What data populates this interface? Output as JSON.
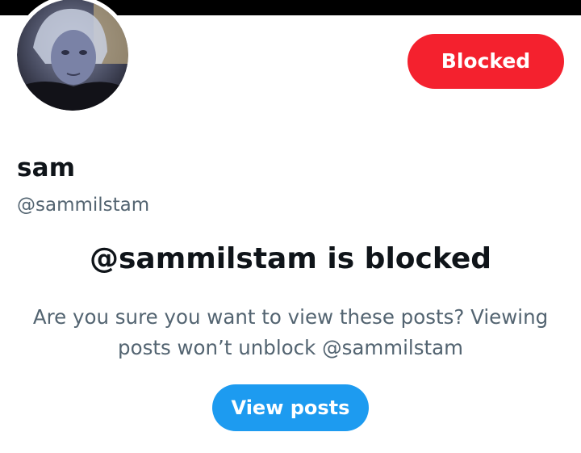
{
  "profile": {
    "name": "sam",
    "handle": "@sammilstam",
    "avatar_alt": "profile photo"
  },
  "actions": {
    "blocked_label": "Blocked",
    "view_posts_label": "View posts"
  },
  "blocked_notice": {
    "heading": "@sammilstam is blocked",
    "description": "Are you sure you want to view these posts? Viewing posts won’t unblock @sammilstam"
  },
  "colors": {
    "blocked_red": "#f4212e",
    "primary_blue": "#1d9bf0",
    "text_primary": "#0f1419",
    "text_secondary": "#536471",
    "banner": "#000000"
  }
}
